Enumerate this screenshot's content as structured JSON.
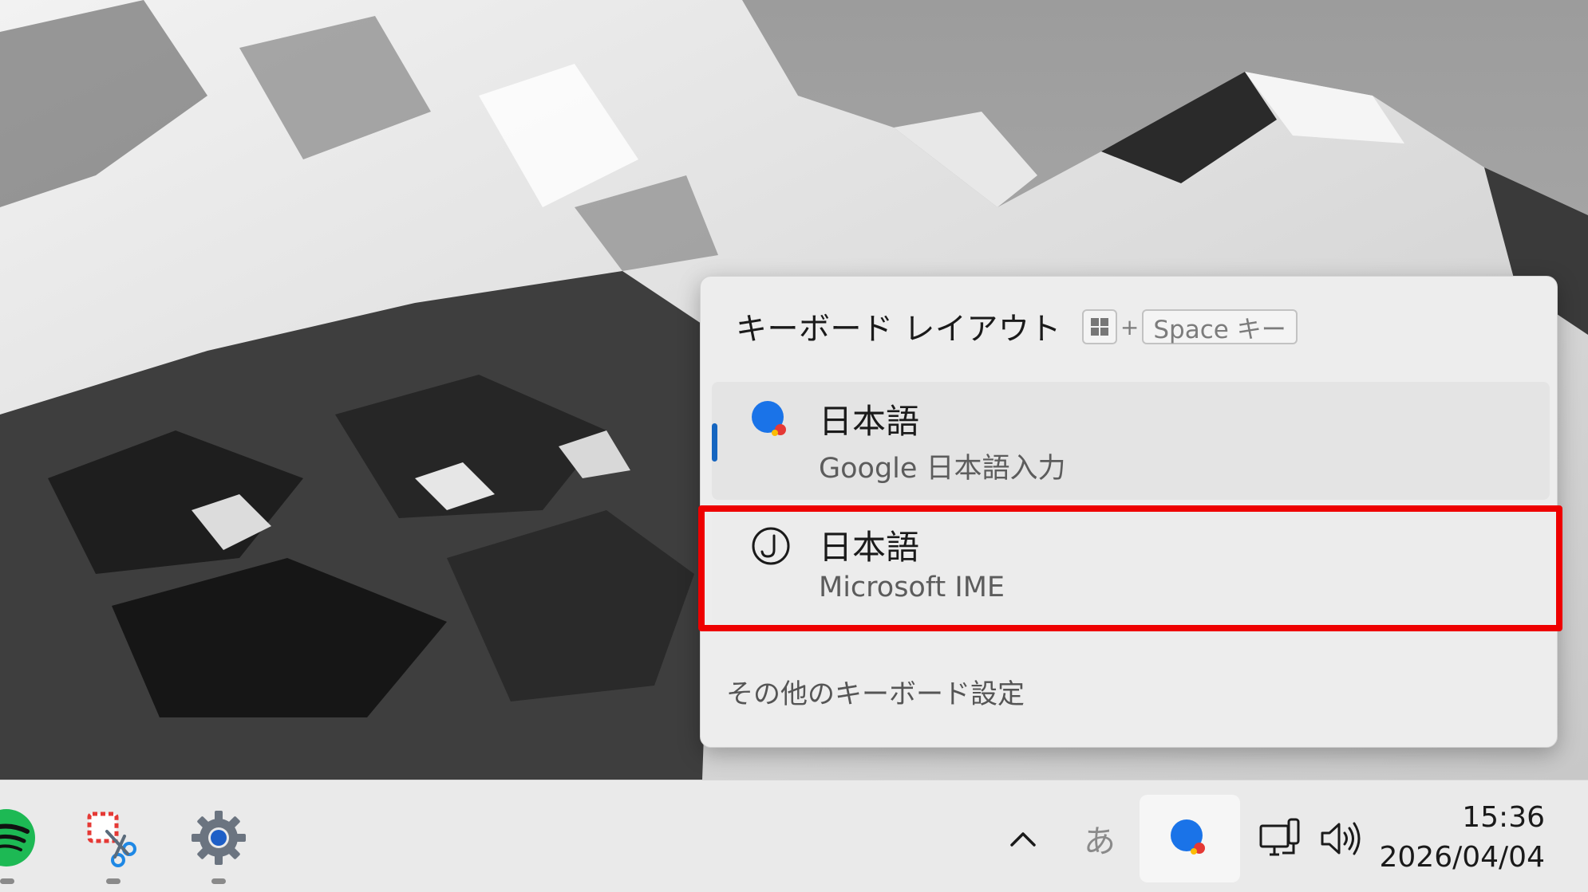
{
  "flyout": {
    "title": "キーボード レイアウト",
    "shortcut": {
      "key_plus": "+",
      "space_label": "Space キー"
    },
    "items": [
      {
        "language": "日本語",
        "ime": "Google 日本語入力",
        "icon": "google-ime-icon",
        "selected": true
      },
      {
        "language": "日本語",
        "ime": "Microsoft IME",
        "icon": "microsoft-ime-icon",
        "selected": false,
        "highlighted": true
      }
    ],
    "more_settings": "その他のキーボード設定"
  },
  "taskbar": {
    "apps": [
      {
        "name": "spotify",
        "icon": "spotify-icon"
      },
      {
        "name": "snipping-tool",
        "icon": "snipping-tool-icon"
      },
      {
        "name": "settings",
        "icon": "gear-icon"
      }
    ],
    "tray": {
      "overflow_icon": "chevron-up-icon",
      "ime_mode": "あ",
      "active_ime_icon": "google-ime-icon",
      "network_icon": "network-icon",
      "volume_icon": "speaker-icon"
    },
    "clock": {
      "time": "15:36",
      "date": "2026/04/04"
    }
  },
  "colors": {
    "highlight": "#ee0000",
    "selection_bar": "#1565c0",
    "google_blue": "#1a73e8",
    "google_red": "#e53935",
    "google_yellow": "#fbbc04",
    "spotify_green": "#1db954"
  }
}
